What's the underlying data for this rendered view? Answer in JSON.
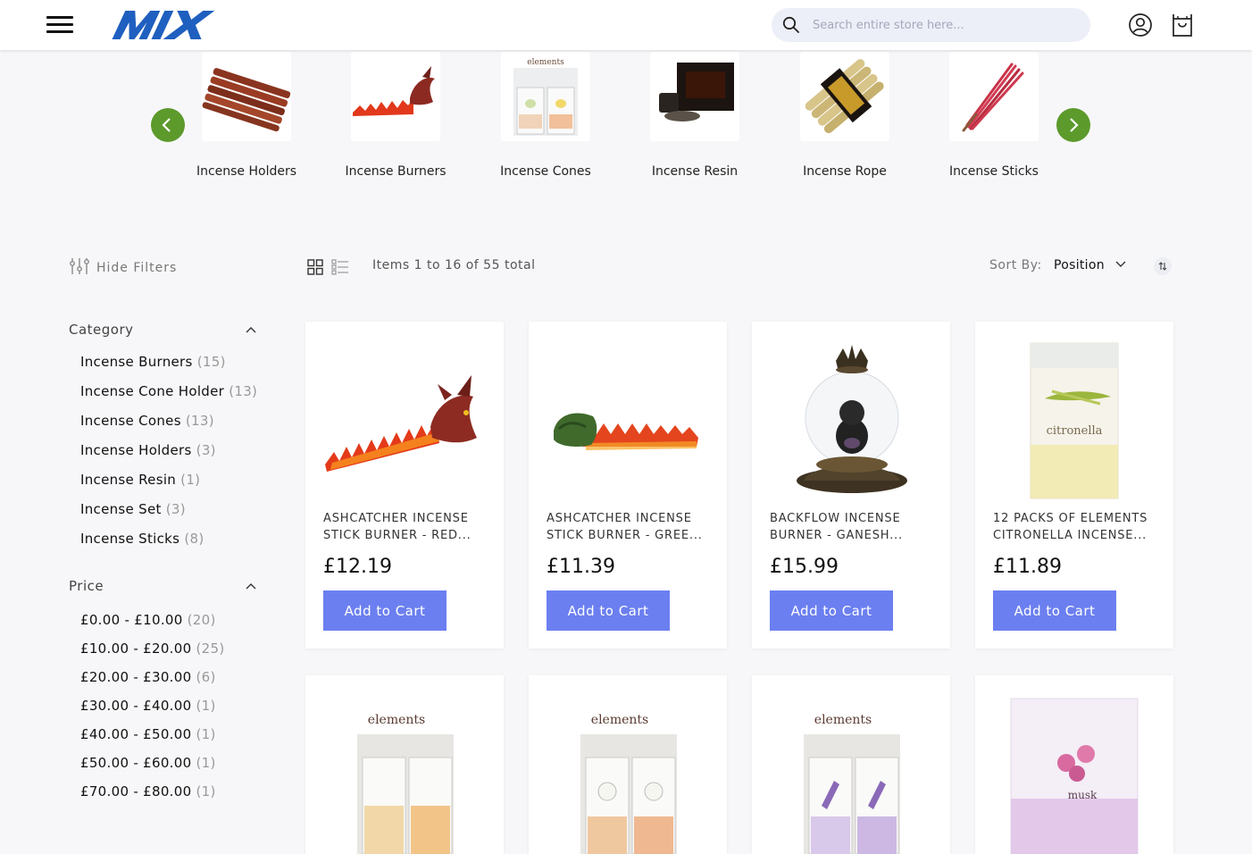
{
  "header": {
    "search_placeholder": "Search entire store here...",
    "colors": {
      "logo": "#1f5fbf",
      "accent": "#6b7ff0"
    }
  },
  "categories": [
    {
      "label": "Incense Holders"
    },
    {
      "label": "Incense Burners"
    },
    {
      "label": "Incense Cones"
    },
    {
      "label": "Incense Resin"
    },
    {
      "label": "Incense Rope"
    },
    {
      "label": "Incense Sticks"
    }
  ],
  "toolbar": {
    "hide_filters": "Hide Filters",
    "items_count": "Items 1 to 16 of 55 total",
    "sort_label": "Sort By:",
    "sort_value": "Position"
  },
  "filters": {
    "category": {
      "title": "Category",
      "items": [
        {
          "label": "Incense Burners",
          "count": "(15)"
        },
        {
          "label": "Incense Cone Holder",
          "count": "(13)"
        },
        {
          "label": "Incense Cones",
          "count": "(13)"
        },
        {
          "label": "Incense Holders",
          "count": "(3)"
        },
        {
          "label": "Incense Resin",
          "count": "(1)"
        },
        {
          "label": "Incense Set",
          "count": "(3)"
        },
        {
          "label": "Incense Sticks",
          "count": "(8)"
        }
      ]
    },
    "price": {
      "title": "Price",
      "items": [
        {
          "label": "£0.00 - £10.00",
          "count": "(20)"
        },
        {
          "label": "£10.00 - £20.00",
          "count": "(25)"
        },
        {
          "label": "£20.00 - £30.00",
          "count": "(6)"
        },
        {
          "label": "£30.00 - £40.00",
          "count": "(1)"
        },
        {
          "label": "£40.00 - £50.00",
          "count": "(1)"
        },
        {
          "label": "£50.00 - £60.00",
          "count": "(1)"
        },
        {
          "label": "£70.00 - £80.00",
          "count": "(1)"
        }
      ]
    }
  },
  "products": [
    {
      "name": "ASHCATCHER INCENSE STICK BURNER - RED...",
      "price": "£12.19",
      "button": "Add to Cart"
    },
    {
      "name": "ASHCATCHER INCENSE STICK BURNER - GREE...",
      "price": "£11.39",
      "button": "Add to Cart"
    },
    {
      "name": "BACKFLOW INCENSE BURNER - GANESH...",
      "price": "£15.99",
      "button": "Add to Cart"
    },
    {
      "name": "12 PACKS OF ELEMENTS CITRONELLA INCENSE...",
      "price": "£11.89",
      "button": "Add to Cart"
    },
    {
      "name": "",
      "price": "",
      "button": ""
    },
    {
      "name": "",
      "price": "",
      "button": ""
    },
    {
      "name": "",
      "price": "",
      "button": ""
    },
    {
      "name": "",
      "price": "",
      "button": ""
    }
  ]
}
